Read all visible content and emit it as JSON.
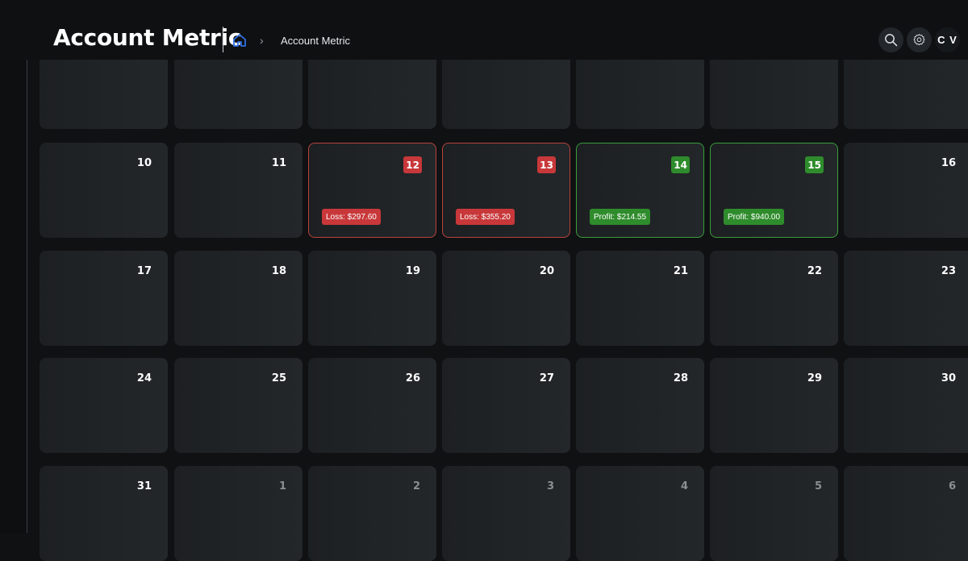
{
  "header": {
    "title": "Account Metric",
    "breadcrumb_separator": "›",
    "breadcrumb_current": "Account Metric",
    "avatar_initials": "C V"
  },
  "colors": {
    "loss": "#c8383a",
    "profit": "#2f8c2c",
    "home_icon": "#2f6fe0"
  },
  "calendar": {
    "rows": [
      [
        {
          "day": "",
          "status": "none"
        },
        {
          "day": "",
          "status": "none"
        },
        {
          "day": "",
          "status": "none"
        },
        {
          "day": "",
          "status": "none"
        },
        {
          "day": "",
          "status": "none"
        },
        {
          "day": "",
          "status": "none"
        },
        {
          "day": "",
          "status": "none"
        }
      ],
      [
        {
          "day": "10",
          "status": "none"
        },
        {
          "day": "11",
          "status": "none"
        },
        {
          "day": "12",
          "status": "loss",
          "label": "Loss: $297.60"
        },
        {
          "day": "13",
          "status": "loss",
          "label": "Loss: $355.20"
        },
        {
          "day": "14",
          "status": "profit",
          "label": "Profit: $214.55"
        },
        {
          "day": "15",
          "status": "profit",
          "label": "Profit: $940.00"
        },
        {
          "day": "16",
          "status": "none"
        }
      ],
      [
        {
          "day": "17",
          "status": "none"
        },
        {
          "day": "18",
          "status": "none"
        },
        {
          "day": "19",
          "status": "none"
        },
        {
          "day": "20",
          "status": "none"
        },
        {
          "day": "21",
          "status": "none"
        },
        {
          "day": "22",
          "status": "none"
        },
        {
          "day": "23",
          "status": "none"
        }
      ],
      [
        {
          "day": "24",
          "status": "none"
        },
        {
          "day": "25",
          "status": "none"
        },
        {
          "day": "26",
          "status": "none"
        },
        {
          "day": "27",
          "status": "none"
        },
        {
          "day": "28",
          "status": "none"
        },
        {
          "day": "29",
          "status": "none"
        },
        {
          "day": "30",
          "status": "none"
        }
      ],
      [
        {
          "day": "31",
          "status": "none"
        },
        {
          "day": "1",
          "status": "none",
          "muted": true
        },
        {
          "day": "2",
          "status": "none",
          "muted": true
        },
        {
          "day": "3",
          "status": "none",
          "muted": true
        },
        {
          "day": "4",
          "status": "none",
          "muted": true
        },
        {
          "day": "5",
          "status": "none",
          "muted": true
        },
        {
          "day": "6",
          "status": "none",
          "muted": true
        }
      ]
    ]
  }
}
